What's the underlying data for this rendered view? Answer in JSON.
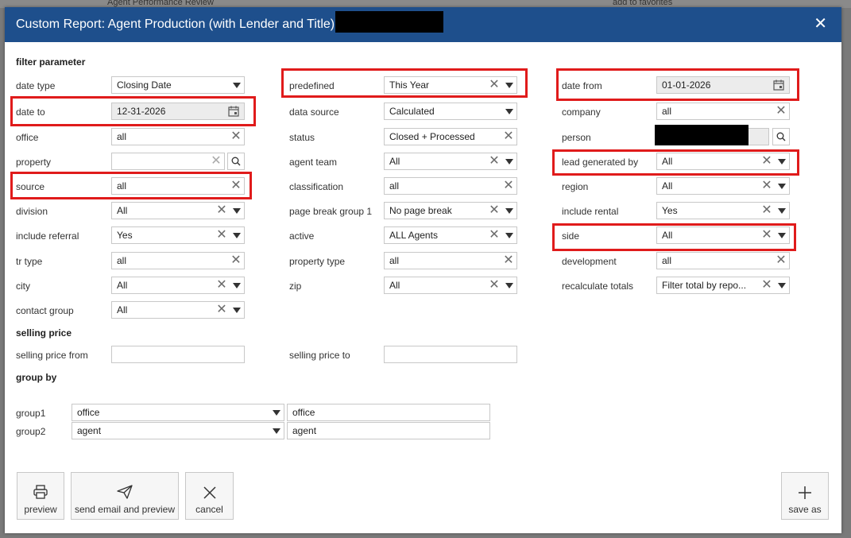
{
  "background": {
    "text_left": "Agent Performance Review",
    "text_right": "add to favorites"
  },
  "dialog": {
    "title": "Custom Report: Agent Production (with Lender and Title)",
    "close_icon": "close-icon"
  },
  "sections": {
    "filter": "filter parameter",
    "selling_price": "selling price",
    "group_by": "group by"
  },
  "filters": {
    "date_type": {
      "label": "date type",
      "value": "Closing Date"
    },
    "date_to": {
      "label": "date to",
      "value": "12-31-2026"
    },
    "office": {
      "label": "office",
      "value": "all"
    },
    "property": {
      "label": "property",
      "value": ""
    },
    "source": {
      "label": "source",
      "value": "all"
    },
    "division": {
      "label": "division",
      "value": "All"
    },
    "include_referral": {
      "label": "include referral",
      "value": "Yes"
    },
    "tr_type": {
      "label": "tr type",
      "value": "all"
    },
    "city": {
      "label": "city",
      "value": "All"
    },
    "contact_group": {
      "label": "contact group",
      "value": "All"
    },
    "predefined": {
      "label": "predefined",
      "value": "This Year"
    },
    "data_source": {
      "label": "data source",
      "value": "Calculated"
    },
    "status": {
      "label": "status",
      "value": "Closed + Processed"
    },
    "agent_team": {
      "label": "agent team",
      "value": "All"
    },
    "classification": {
      "label": "classification",
      "value": "all"
    },
    "page_break_group_1": {
      "label": "page break group 1",
      "value": "No page break"
    },
    "active": {
      "label": "active",
      "value": "ALL Agents"
    },
    "property_type": {
      "label": "property type",
      "value": "all"
    },
    "zip": {
      "label": "zip",
      "value": "All"
    },
    "date_from": {
      "label": "date from",
      "value": "01-01-2026"
    },
    "company": {
      "label": "company",
      "value": "all"
    },
    "person": {
      "label": "person",
      "value": ""
    },
    "lead_generated_by": {
      "label": "lead generated by",
      "value": "All"
    },
    "region": {
      "label": "region",
      "value": "All"
    },
    "include_rental": {
      "label": "include rental",
      "value": "Yes"
    },
    "side": {
      "label": "side",
      "value": "All"
    },
    "development": {
      "label": "development",
      "value": "all"
    },
    "recalculate_totals": {
      "label": "recalculate totals",
      "value": "Filter total by repo..."
    }
  },
  "selling_price": {
    "from_label": "selling price from",
    "from_value": "",
    "to_label": "selling price to",
    "to_value": ""
  },
  "group_by": {
    "group1_label": "group1",
    "group1_select": "office",
    "group1_text": "office",
    "group2_label": "group2",
    "group2_select": "agent",
    "group2_text": "agent"
  },
  "buttons": {
    "preview": {
      "label": "preview",
      "icon": "printer-icon"
    },
    "send_email": {
      "label": "send email and preview",
      "icon": "send-icon"
    },
    "cancel": {
      "label": "cancel",
      "icon": "close-icon"
    },
    "save_as": {
      "label": "save as",
      "icon": "plus-icon"
    }
  },
  "colors": {
    "titlebar": "#1e4f8c",
    "highlight": "#e01b1b"
  }
}
